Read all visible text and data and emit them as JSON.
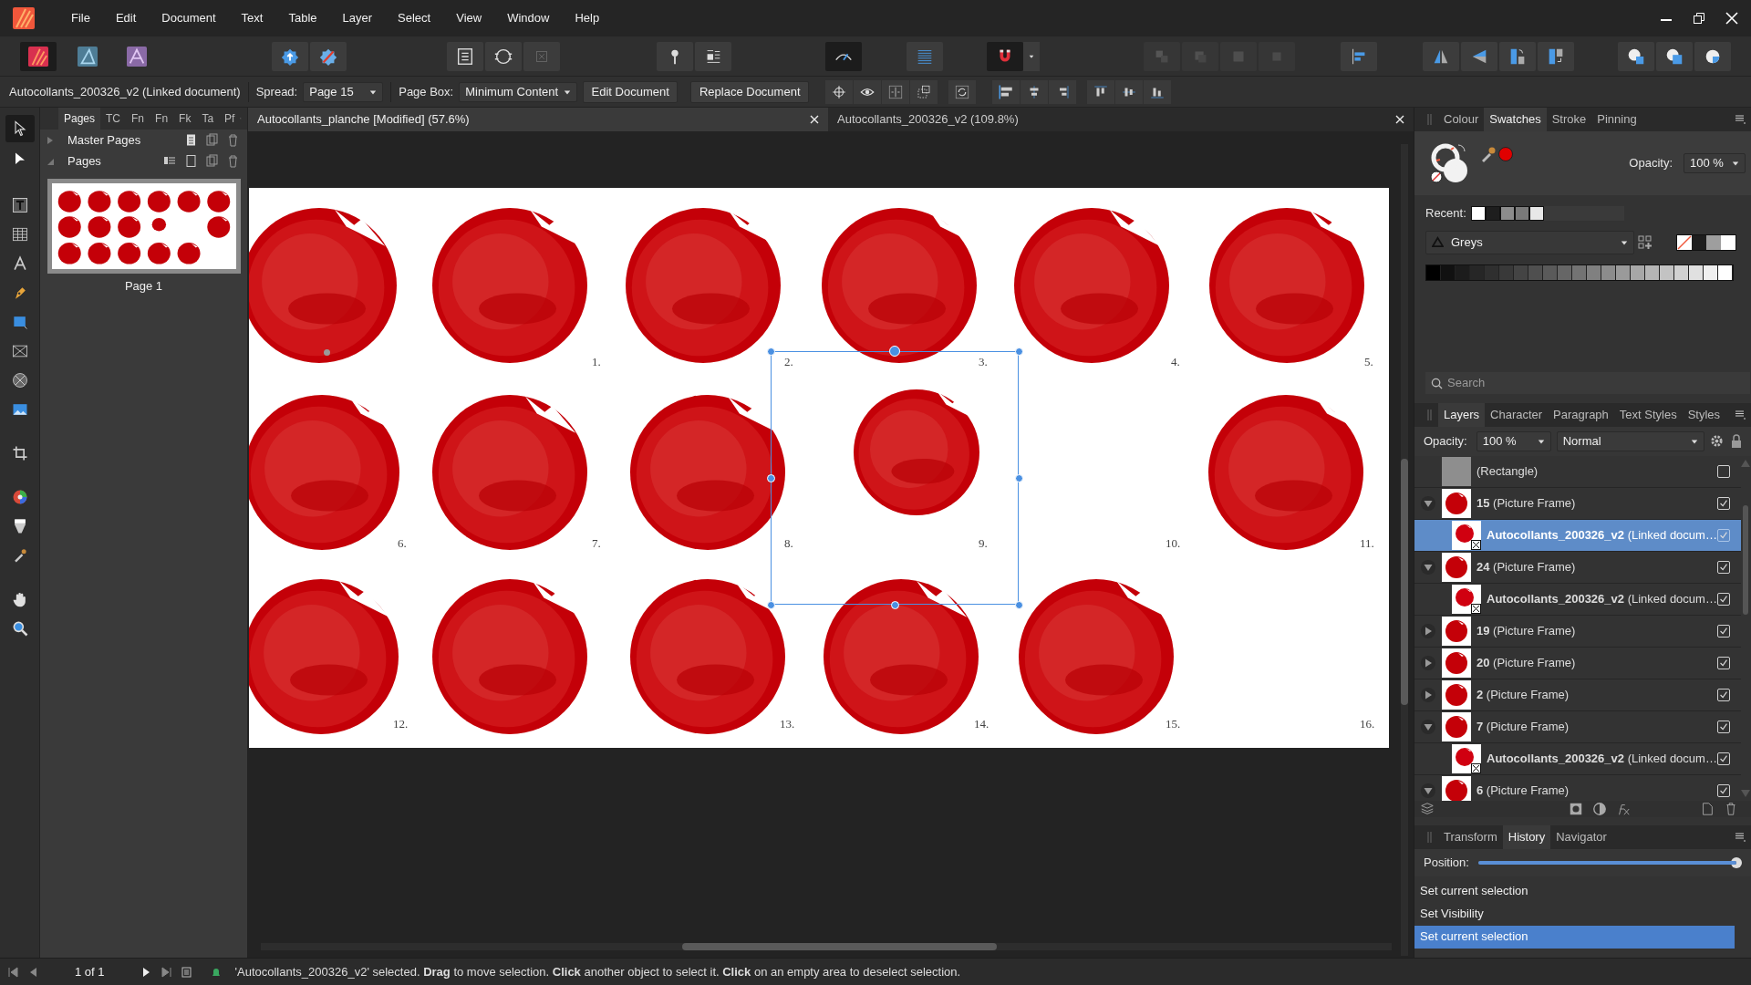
{
  "menu": [
    "File",
    "Edit",
    "Document",
    "Text",
    "Table",
    "Layer",
    "Select",
    "View",
    "Window",
    "Help"
  ],
  "context_bar": {
    "object": "Autocollants_200326_v2 (Linked document)",
    "spread_label": "Spread:",
    "spread": "Page 15",
    "page_box_label": "Page Box:",
    "page_box": "Minimum Content",
    "buttons": [
      "Edit Document",
      "Replace Document"
    ]
  },
  "tools": [
    {
      "kind": "move",
      "selected": true
    },
    {
      "kind": "node",
      "selected": false
    },
    {
      "kind": "frame-text",
      "selected": false
    },
    {
      "kind": "table",
      "selected": false
    },
    {
      "kind": "artistic-text",
      "selected": false
    },
    {
      "kind": "pen",
      "selected": false
    },
    {
      "kind": "rectangle",
      "selected": false
    },
    {
      "kind": "picture-frame",
      "selected": false
    },
    {
      "kind": "ellipse-frame",
      "selected": false
    },
    {
      "kind": "place-image",
      "selected": false
    },
    {
      "kind": "crop",
      "selected": false
    },
    {
      "kind": "colour-wheel",
      "selected": false
    },
    {
      "kind": "fill",
      "selected": false
    },
    {
      "kind": "eyedropper",
      "selected": false
    },
    {
      "kind": "hand",
      "selected": false
    },
    {
      "kind": "zoom",
      "selected": false
    }
  ],
  "pages_panel": {
    "tabs": [
      {
        "label": "Pages",
        "selected": true
      },
      {
        "label": "TC",
        "selected": false
      },
      {
        "label": "Fn",
        "selected": false
      },
      {
        "label": "Fn",
        "selected": false
      },
      {
        "label": "Fk",
        "selected": false
      },
      {
        "label": "Ta",
        "selected": false
      },
      {
        "label": "Pf",
        "selected": false
      }
    ],
    "sections": [
      {
        "label": "Master Pages",
        "expanded": false
      },
      {
        "label": "Pages",
        "expanded": true
      }
    ],
    "pages": [
      {
        "label": "Page 1",
        "selected": true
      }
    ]
  },
  "document_tabs": [
    {
      "label": "Autocollants_planche [Modified] (57.6%)",
      "selected": true
    },
    {
      "label": "Autocollants_200326_v2 (109.8%)",
      "selected": false
    }
  ],
  "canvas": {
    "labels": [
      "1.",
      "2.",
      "3.",
      "4.",
      "5.",
      "6.",
      "7.",
      "8.",
      "9.",
      "10.",
      "11.",
      "12.",
      "13.",
      "14.",
      "15.",
      "16."
    ]
  },
  "colour_panel": {
    "tabs": [
      {
        "label": "Colour",
        "selected": false
      },
      {
        "label": "Swatches",
        "selected": true
      },
      {
        "label": "Stroke",
        "selected": false
      },
      {
        "label": "Pinning",
        "selected": false
      }
    ],
    "opacity_label": "Opacity:",
    "opacity": "100 %",
    "recent_label": "Recent:",
    "recent": [
      {
        "color": "#ffffff"
      },
      {
        "color": "#1e1e1e"
      },
      {
        "color": "#8c8c8c"
      },
      {
        "color": "#7a7a7a"
      },
      {
        "color": "#e8e8e8"
      }
    ],
    "palette": "Greys",
    "quick": [
      {
        "color": "#1e1e1e"
      },
      {
        "color": "#9e9e9e"
      },
      {
        "color": "#ffffff"
      }
    ],
    "swatches": [
      {
        "color": "#000000"
      },
      {
        "color": "#111111"
      },
      {
        "color": "#1c1c1c"
      },
      {
        "color": "#262626"
      },
      {
        "color": "#2f2f2f"
      },
      {
        "color": "#393939"
      },
      {
        "color": "#444444"
      },
      {
        "color": "#4f4f4f"
      },
      {
        "color": "#5a5a5a"
      },
      {
        "color": "#666666"
      },
      {
        "color": "#737373"
      },
      {
        "color": "#808080"
      },
      {
        "color": "#8c8c8c"
      },
      {
        "color": "#9a9a9a"
      },
      {
        "color": "#a7a7a7"
      },
      {
        "color": "#b5b5b5"
      },
      {
        "color": "#c3c3c3"
      },
      {
        "color": "#d1d1d1"
      },
      {
        "color": "#e0e0e0"
      },
      {
        "color": "#efefef"
      },
      {
        "color": "#ffffff"
      }
    ],
    "search_placeholder": "Search"
  },
  "layers_panel": {
    "tabs": [
      {
        "label": "Layers",
        "selected": true
      },
      {
        "label": "Character",
        "selected": false
      },
      {
        "label": "Paragraph",
        "selected": false
      },
      {
        "label": "Text Styles",
        "selected": false
      },
      {
        "label": "Styles",
        "selected": false
      }
    ],
    "opacity_label": "Opacity:",
    "opacity": "100 %",
    "blend_mode": "Normal",
    "layers": [
      {
        "label": "(Rectangle)",
        "kind": "shape",
        "visible": false,
        "selected": false
      },
      {
        "label": "**15** (Picture Frame)",
        "kind": "frame",
        "visible": true,
        "selected": false,
        "expanded": true,
        "children": [
          {
            "label": "**Autocollants_200326_v2** (Linked docum…",
            "kind": "linked",
            "visible": true,
            "selected": true
          }
        ]
      },
      {
        "label": "**24** (Picture Frame)",
        "kind": "frame",
        "visible": true,
        "selected": false,
        "expanded": true,
        "children": [
          {
            "label": "**Autocollants_200326_v2** (Linked docum…",
            "kind": "linked",
            "visible": true,
            "selected": false
          }
        ]
      },
      {
        "label": "**19** (Picture Frame)",
        "kind": "frame",
        "visible": true,
        "selected": false,
        "expanded": false
      },
      {
        "label": "**20** (Picture Frame)",
        "kind": "frame",
        "visible": true,
        "selected": false,
        "expanded": false
      },
      {
        "label": "**2** (Picture Frame)",
        "kind": "frame",
        "visible": true,
        "selected": false,
        "expanded": false
      },
      {
        "label": "**7** (Picture Frame)",
        "kind": "frame",
        "visible": true,
        "selected": false,
        "expanded": true,
        "children": [
          {
            "label": "**Autocollants_200326_v2** (Linked docum…",
            "kind": "linked",
            "visible": true,
            "selected": false
          }
        ]
      },
      {
        "label": "**6** (Picture Frame)",
        "kind": "frame",
        "visible": true,
        "selected": false,
        "expanded": true
      }
    ]
  },
  "history_panel": {
    "tabs": [
      {
        "label": "Transform",
        "selected": false
      },
      {
        "label": "History",
        "selected": true
      },
      {
        "label": "Navigator",
        "selected": false
      }
    ],
    "position_label": "Position:",
    "position": {
      "level": 1
    },
    "items": [
      {
        "label": "Set current selection",
        "selected": false
      },
      {
        "label": "Set Visibility",
        "selected": false
      },
      {
        "label": "Set current selection",
        "selected": true
      }
    ]
  },
  "status_bar": {
    "page": "1 of 1",
    "message": "'Autocollants_200326_v2' selected. **Drag** to move selection. **Click** another object to select it. **Click** on an empty area to deselect selection."
  }
}
